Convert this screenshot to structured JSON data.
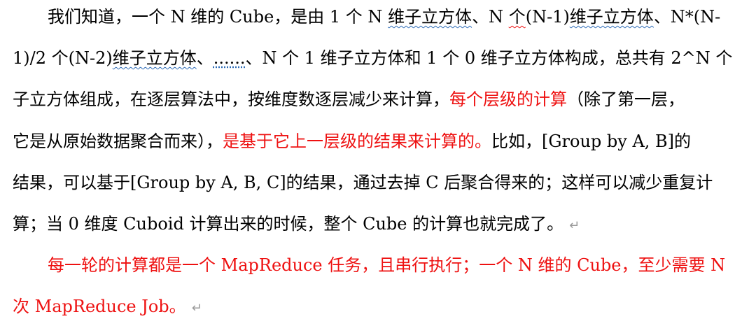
{
  "paragraph1": {
    "line1": {
      "a": "我们知道，一个 N 维的 Cube，是由 1 个 N ",
      "b": "维子立方体",
      "c": "、N ",
      "d": "个",
      "e": "(N-1)",
      "f": "维子立方体",
      "g": "、N*(N-"
    },
    "line2": {
      "a": "1)/2 个(N-2)",
      "b": "维子立方体",
      "c": "、",
      "d": "......",
      "e": "、N 个 1 维子立方体和 1 个 0 维子立方体构成，总共有 2^N 个"
    },
    "line3": {
      "a": "子立方体组成，在逐层算法中，按维度数逐层减少来计算，",
      "b": "每个层级的计算",
      "c": "（除了第一层，"
    },
    "line4": {
      "a": "它是从原始数据聚合而来），",
      "b": "是基于它上一层级的结果来计算的。",
      "c": "比如，[Group by A, B]的"
    },
    "line5": "结果，可以基于[Group by A, B, C]的结果，通过去掉 C 后聚合得来的；这样可以减少重复计",
    "line6": "算；当  0 维度 Cuboid 计算出来的时候，整个 Cube 的计算也就完成了。"
  },
  "paragraph2": {
    "line1": "每一轮的计算都是一个 MapReduce 任务，且串行执行；一个 N 维的 Cube，至少需要 N",
    "line2": "次 MapReduce Job。"
  },
  "paragraph_mark": "↵"
}
